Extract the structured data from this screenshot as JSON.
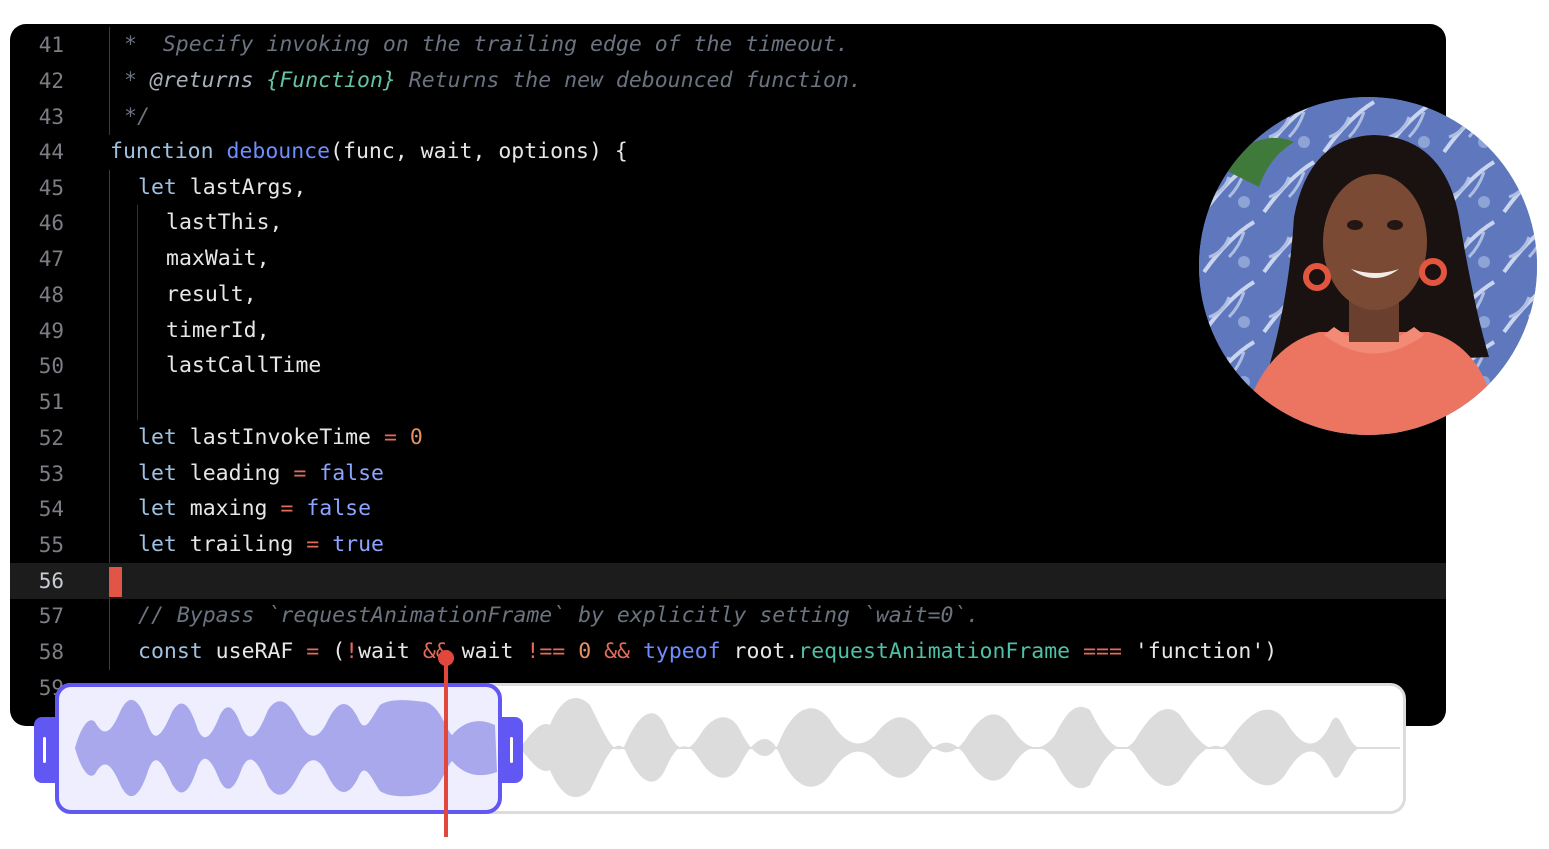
{
  "editor": {
    "current_line": "56",
    "lines": [
      {
        "n": "41"
      },
      {
        "n": "42"
      },
      {
        "n": "43"
      },
      {
        "n": "44"
      },
      {
        "n": "45"
      },
      {
        "n": "46"
      },
      {
        "n": "47"
      },
      {
        "n": "48"
      },
      {
        "n": "49"
      },
      {
        "n": "50"
      },
      {
        "n": "51"
      },
      {
        "n": "52"
      },
      {
        "n": "53"
      },
      {
        "n": "54"
      },
      {
        "n": "55"
      },
      {
        "n": "56"
      },
      {
        "n": "57"
      },
      {
        "n": "58"
      },
      {
        "n": "59"
      }
    ],
    "code": {
      "l41": "*  Specify invoking on the trailing edge of the timeout.",
      "l42_star": "* ",
      "l42_tag": "@returns",
      "l42_type": "{Function}",
      "l42_rest": " Returns the new debounced function.",
      "l43": "*/",
      "l44_kw": "function",
      "l44_fn": "debounce",
      "l44_rest": "(func, wait, options) {",
      "l45_kw": "let",
      "l45_rest": " lastArgs,",
      "l46": "lastThis,",
      "l47": "maxWait,",
      "l48": "result,",
      "l49": "timerId,",
      "l50": "lastCallTime",
      "l52_kw": "let",
      "l52_name": " lastInvokeTime ",
      "l52_op": "=",
      "l52_val": "0",
      "l53_kw": "let",
      "l53_name": " leading ",
      "l53_op": "=",
      "l53_val": "false",
      "l54_kw": "let",
      "l54_name": " maxing ",
      "l54_op": "=",
      "l54_val": "false",
      "l55_kw": "let",
      "l55_name": " trailing ",
      "l55_op": "=",
      "l55_val": "true",
      "l57": "// Bypass `requestAnimationFrame` by explicitly setting `wait=0`.",
      "l58_kw": "const",
      "l58_a": " useRAF ",
      "l58_op1": "=",
      "l58_b": " (",
      "l58_op2": "!",
      "l58_c": "wait ",
      "l58_op3": "&&",
      "l58_d": " wait ",
      "l58_op4": "!==",
      "l58_num": "0",
      "l58_op5": "&&",
      "l58_kw2": "typeof",
      "l58_e": " root.",
      "l58_prop": "requestAnimationFrame",
      "l58_op6": "===",
      "l58_str": "'function')"
    }
  },
  "avatar": {
    "icon": "presenter-video-icon"
  },
  "timeline": {
    "selection_start": 0.0,
    "selection_end": 0.33,
    "playhead": 0.29,
    "colors": {
      "accent": "#6157f3",
      "selected_wave": "#a9a8ec",
      "wave": "#dcdcdc",
      "playhead": "#e2473d"
    }
  }
}
